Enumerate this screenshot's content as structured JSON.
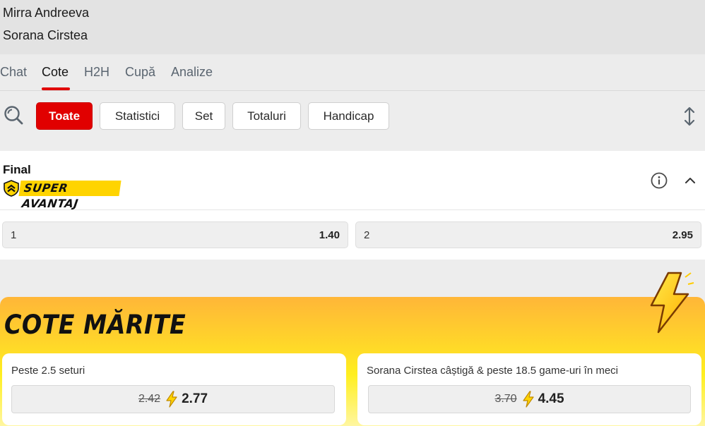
{
  "match": {
    "player1": "Mirra Andreeva",
    "player2": "Sorana Cirstea"
  },
  "tabs": [
    {
      "label": "Chat"
    },
    {
      "label": "Cote"
    },
    {
      "label": "H2H"
    },
    {
      "label": "Cupă"
    },
    {
      "label": "Analize"
    }
  ],
  "active_tab": "Cote",
  "filters": [
    {
      "label": "Toate"
    },
    {
      "label": "Statistici"
    },
    {
      "label": "Set"
    },
    {
      "label": "Totaluri"
    },
    {
      "label": "Handicap"
    }
  ],
  "active_filter": "Toate",
  "icons": {
    "search": "search-icon",
    "sort": "sort-arrows-icon",
    "info": "info-icon",
    "collapse": "chevron-up-icon",
    "bolt": "lightning-bolt-icon",
    "shield": "shield-icon"
  },
  "market": {
    "title": "Final",
    "badge": "SUPER AVANTAJ",
    "outcomes": [
      {
        "label": "1",
        "odd": "1.40"
      },
      {
        "label": "2",
        "odd": "2.95"
      }
    ]
  },
  "boosted": {
    "title": "COTE MĂRITE",
    "items": [
      {
        "description": "Peste 2.5 seturi",
        "old_odd": "2.42",
        "new_odd": "2.77"
      },
      {
        "description": "Sorana Cirstea câștigă & peste 18.5 game-uri în meci",
        "old_odd": "3.70",
        "new_odd": "4.45"
      }
    ]
  },
  "colors": {
    "accent": "#e10000",
    "badge_yellow": "#ffd400",
    "boost_gradient_top": "#ffb638",
    "boost_gradient_bottom": "#fff6a0"
  }
}
